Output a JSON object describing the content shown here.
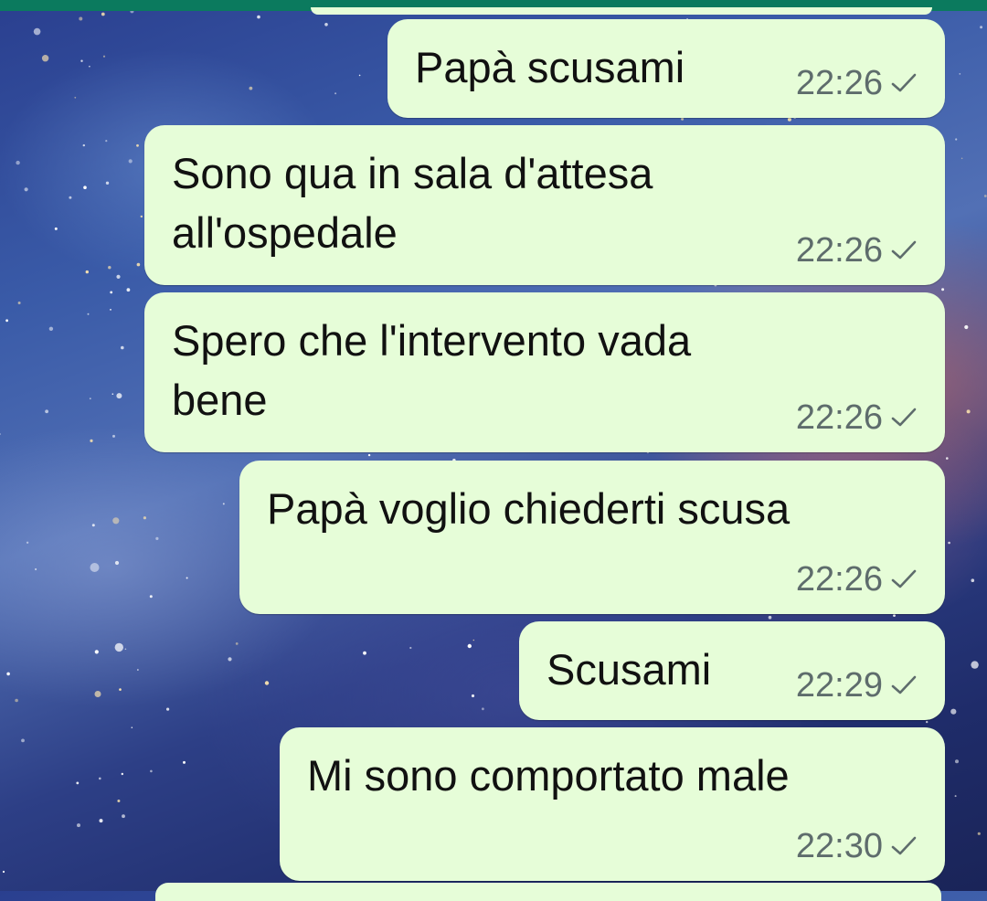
{
  "conversation": {
    "messages": [
      {
        "text": "Papà scusami",
        "time": "22:26",
        "status": "sent-check-icon"
      },
      {
        "text": "Sono qua in sala d'attesa\nall'ospedale",
        "time": "22:26",
        "status": "sent-check-icon"
      },
      {
        "text": "Spero che l'intervento vada\nbene",
        "time": "22:26",
        "status": "sent-check-icon"
      },
      {
        "text": "Papà voglio chiederti scusa",
        "time": "22:26",
        "status": "sent-check-icon"
      },
      {
        "text": "Scusami",
        "time": "22:29",
        "status": "sent-check-icon"
      },
      {
        "text": "Mi sono comportato male",
        "time": "22:30",
        "status": "sent-check-icon"
      }
    ]
  },
  "colors": {
    "bubble_outgoing": "#e6fdd8",
    "time_text": "#5e6c6c",
    "top_bar": "#0b7a5e"
  }
}
